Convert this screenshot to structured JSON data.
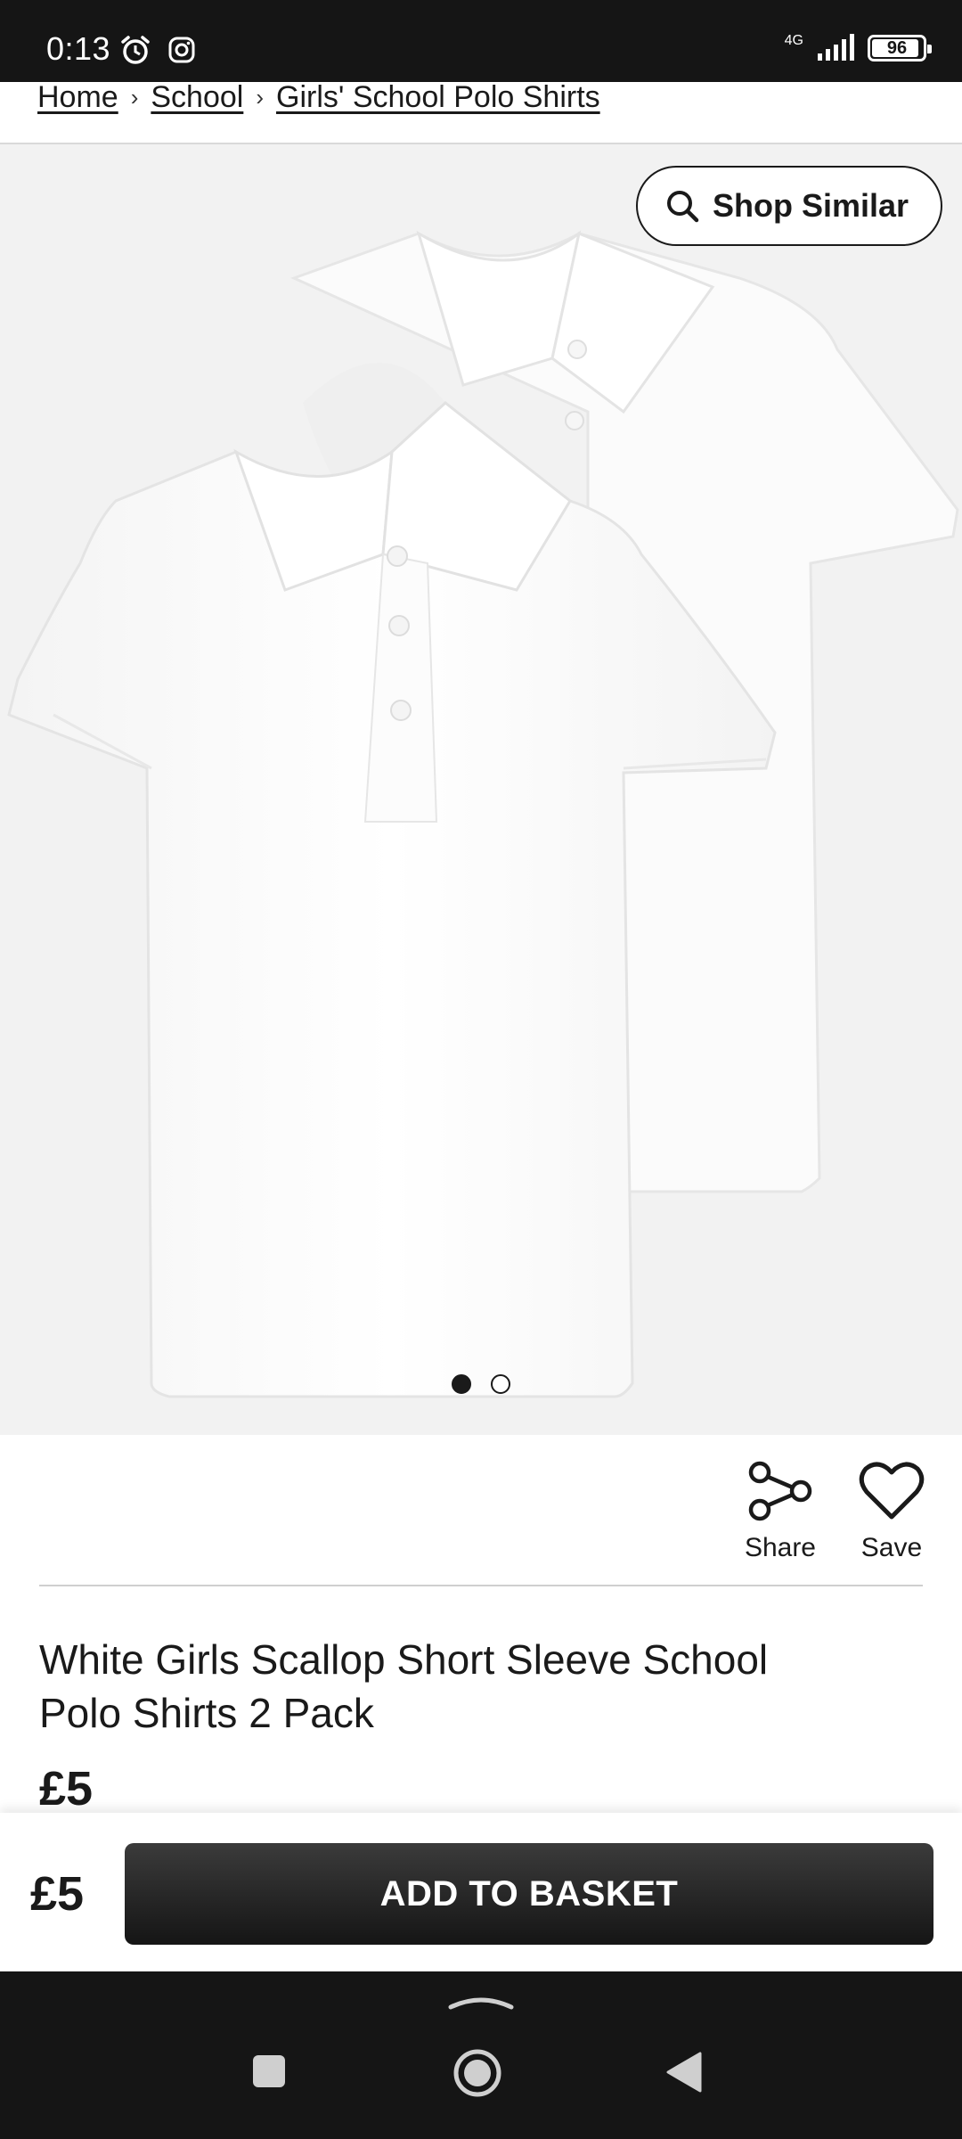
{
  "status_bar": {
    "time": "0:13",
    "network": "4G",
    "battery": "96"
  },
  "breadcrumb": [
    {
      "label": "Home"
    },
    {
      "label": "School"
    },
    {
      "label": "Girls' School Polo Shirts"
    }
  ],
  "gallery": {
    "shop_similar_label": "Shop Similar",
    "image_count": 2,
    "active_image": 1
  },
  "actions": {
    "share_label": "Share",
    "save_label": "Save"
  },
  "product": {
    "title": "White Girls Scallop Short Sleeve School Polo Shirts 2 Pack",
    "price": "£5"
  },
  "basket": {
    "price": "£5",
    "button_label": "ADD TO BASKET"
  },
  "icons": [
    "alarm-icon",
    "instagram-icon",
    "signal-icon",
    "battery-icon",
    "search-icon",
    "share-icon",
    "heart-icon",
    "chevron-right-icon",
    "nav-recents-icon",
    "nav-home-icon",
    "nav-back-icon"
  ],
  "colors": {
    "status_bar": "#151515",
    "button": "#1a1a1a",
    "image_bg": "#f2f2f2"
  }
}
